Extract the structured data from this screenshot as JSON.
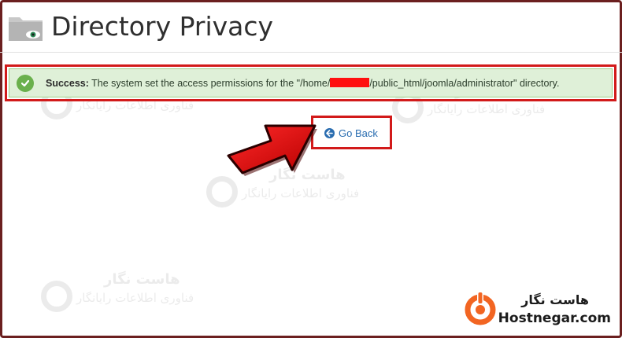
{
  "page": {
    "title": "Directory Privacy"
  },
  "alert": {
    "label": "Success:",
    "message_before": "The system set the access permissions for the \"/home/",
    "message_after": "/public_html/joomla/administrator\" directory.",
    "status_color": "#6ab04c"
  },
  "actions": {
    "go_back_label": "Go Back"
  },
  "watermark": {
    "title": "هاست نگار",
    "subtitle": "فناوری اطلاعات رایانگار"
  },
  "brand": {
    "name_fa": "هاست نگار",
    "site": "Hostnegar.com",
    "accent_color": "#f26522"
  },
  "icons": {
    "header": "folder-eye-icon",
    "alert": "check-circle-icon",
    "go_back": "arrow-circle-left-icon",
    "annotation": "red-arrow-pointer"
  }
}
